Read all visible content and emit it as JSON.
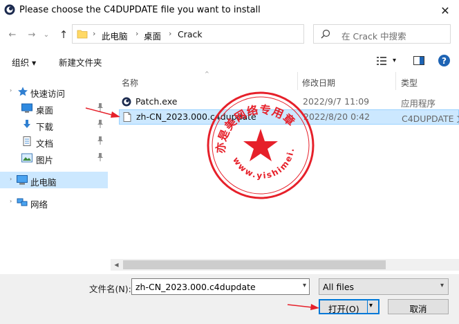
{
  "window": {
    "title": "Please choose the C4DUPDATE file you want to install",
    "close_glyph": "✕"
  },
  "nav": {
    "back_glyph": "←",
    "forward_glyph": "→",
    "recent_glyph": "⌄",
    "up_glyph": "↑",
    "breadcrumb": [
      "此电脑",
      "桌面",
      "Crack"
    ],
    "breadcrumb_sep": "›",
    "address_dropdown_glyph": "⌄",
    "refresh_glyph": "↻",
    "search_placeholder": "在 Crack 中搜索"
  },
  "toolbar": {
    "organize_label": "组织 ▾",
    "new_folder_label": "新建文件夹",
    "view_dropdown_glyph": "▾",
    "help_glyph": "?"
  },
  "sidebar": {
    "items": [
      {
        "label": "快速访问",
        "icon": "star-icon"
      },
      {
        "label": "桌面",
        "icon": "desktop-icon"
      },
      {
        "label": "下载",
        "icon": "download-icon"
      },
      {
        "label": "文档",
        "icon": "documents-icon"
      },
      {
        "label": "图片",
        "icon": "pictures-icon"
      },
      {
        "label": "此电脑",
        "icon": "computer-icon"
      },
      {
        "label": "网络",
        "icon": "network-icon"
      }
    ]
  },
  "columns": {
    "name": "名称",
    "modified": "修改日期",
    "type": "类型"
  },
  "files": [
    {
      "name": "Patch.exe",
      "date": "2022/9/7 11:09",
      "type": "应用程序"
    },
    {
      "name": "zh-CN_2023.000.c4dupdate",
      "date": "2022/8/20 0:42",
      "type": "C4DUPDATE 文"
    }
  ],
  "footer": {
    "filename_label": "文件名(N):",
    "filename_value": "zh-CN_2023.000.c4dupdate",
    "filetype_value": "All files",
    "open_label": "打开(O)",
    "cancel_label": "取消",
    "dropdown_glyph": "▾"
  },
  "watermark": {
    "text_top": "亦是美网络专用章",
    "text_bottom": "www.yishimei.cn",
    "color": "#e6202a"
  },
  "colors": {
    "selection": "#cce8ff",
    "accent": "#0078d7",
    "arrow": "#e6202a"
  }
}
